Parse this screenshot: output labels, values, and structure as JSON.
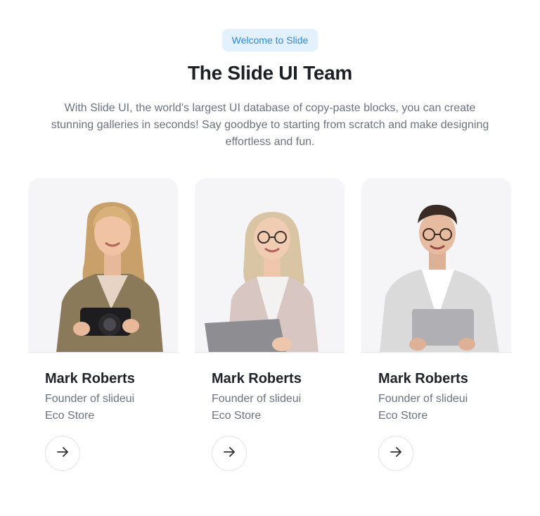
{
  "header": {
    "badge": "Welcome to Slide",
    "title": "The Slide UI Team",
    "description": "With Slide UI, the world's largest UI database of copy-paste blocks, you can create stunning galleries in seconds! Say goodbye to starting from scratch and make designing effortless and fun."
  },
  "team": [
    {
      "name": "Mark Roberts",
      "role": "Founder of slideui",
      "company": "Eco Store",
      "icon": "arrow-right-icon"
    },
    {
      "name": "Mark Roberts",
      "role": "Founder of slideui",
      "company": "Eco Store",
      "icon": "arrow-right-icon"
    },
    {
      "name": "Mark Roberts",
      "role": "Founder of slideui",
      "company": "Eco Store",
      "icon": "arrow-right-icon"
    }
  ],
  "colors": {
    "badge_bg": "#e3f1fe",
    "badge_text": "#2b87da",
    "photo_bg": "#f5f5f7"
  }
}
